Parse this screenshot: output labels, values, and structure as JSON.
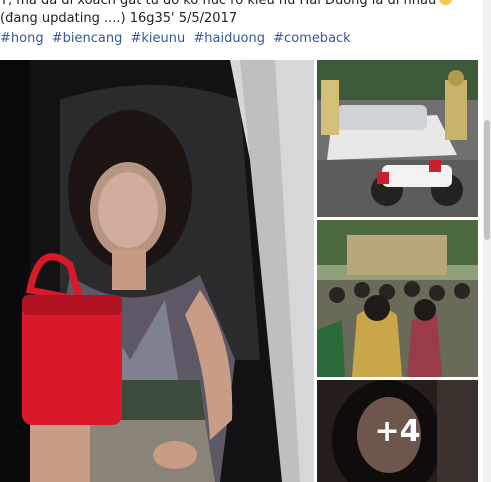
{
  "post": {
    "top_line": "T, ma da di xoach gat tu do ko nuc ro kieu nu Hai Duong la di nhau",
    "status_line": "(đang updating ....) 16g35' 5/5/2017",
    "hashtags": [
      "#hong",
      "#biencang",
      "#kieunu",
      "#haiduong",
      "#comeback"
    ]
  },
  "photos": {
    "more_count_label": "+4"
  },
  "colors": {
    "link": "#365899",
    "text": "#1d2129",
    "accent_bag": "#d9182a"
  }
}
